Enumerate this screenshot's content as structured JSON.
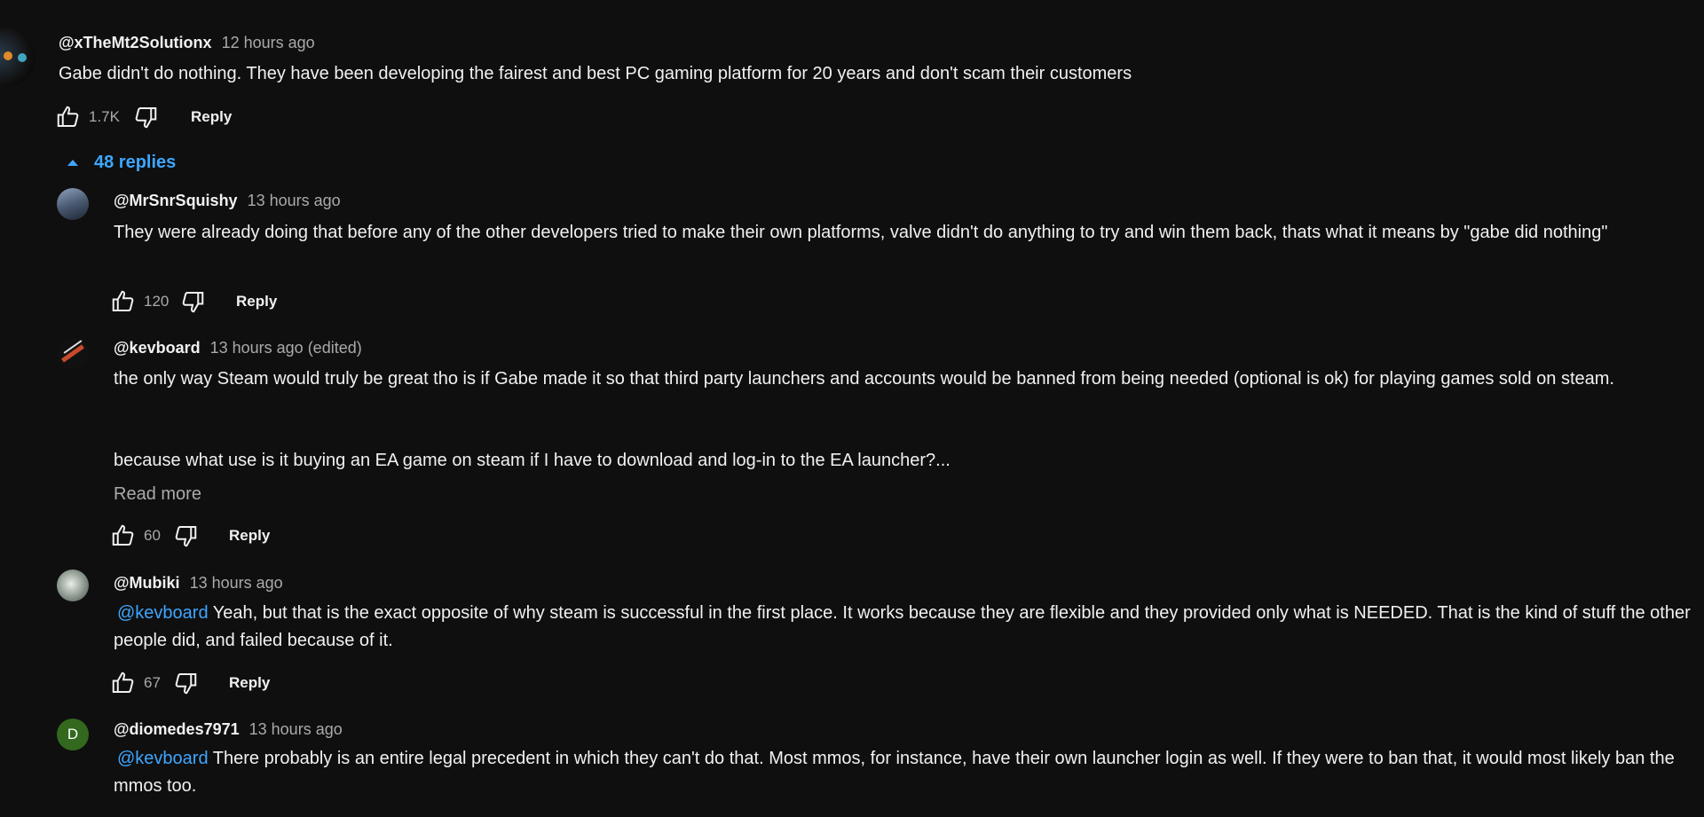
{
  "top_comment": {
    "author": "@xTheMt2Solutionx",
    "time": "12 hours ago",
    "text": "Gabe didn't do nothing. They have been developing the fairest and best PC gaming platform for 20 years and don't scam their customers",
    "likes": "1.7K",
    "reply_label": "Reply",
    "replies_toggle_label": "48 replies"
  },
  "replies": [
    {
      "author": "@MrSnrSquishy",
      "time": "13 hours ago",
      "text": "They were already doing that before any of the other developers tried to make their own platforms, valve didn't do anything to try and win them back, thats what it means by \"gabe did nothing\"",
      "likes": "120",
      "reply_label": "Reply"
    },
    {
      "author": "@kevboard",
      "time": "13 hours ago (edited)",
      "text_p1": "the only way Steam would truly be great tho is if Gabe made it so that third party launchers and accounts would be banned from being needed (optional is ok) for playing games sold on steam.",
      "text_p2": "because what use is it buying an EA game on steam if I have to download and log-in to the EA launcher?...",
      "read_more": "Read more",
      "likes": "60",
      "reply_label": "Reply"
    },
    {
      "author": "@Mubiki",
      "time": "13 hours ago",
      "mention": "@kevboard",
      "text": "Yeah, but that is the exact opposite of why steam is successful in the first place. It works because they are flexible and they provided only what is NEEDED. That is the kind of stuff the other people did, and failed because of it.",
      "likes": "67",
      "reply_label": "Reply"
    },
    {
      "author": "@diomedes7971",
      "time": "13 hours ago",
      "avatar_letter": "D",
      "mention": "@kevboard",
      "text": "There probably is an entire legal precedent in which they can't do that. Most mmos, for instance, have their own launcher login as well. If they were to ban that, it would most likely ban the mmos too."
    }
  ],
  "colors": {
    "background": "#0f0f0f",
    "link": "#3ea6ff",
    "secondary_text": "#aaaaaa",
    "avatar_d": "#33691e"
  },
  "icons": [
    "like-icon",
    "dislike-icon",
    "collapse-triangle-icon"
  ]
}
